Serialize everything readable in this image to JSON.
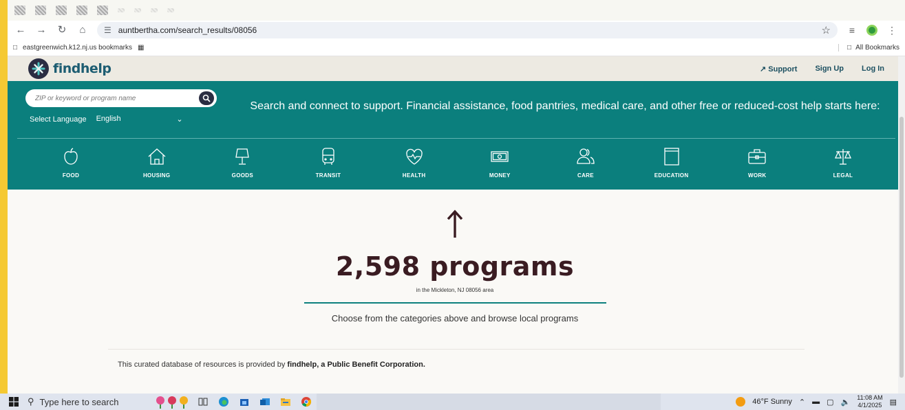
{
  "browser": {
    "url": "auntbertha.com/search_results/08056",
    "bookmark_folder": "eastgreenwich.k12.nj.us bookmarks",
    "all_bookmarks": "All Bookmarks"
  },
  "site": {
    "logo_text": "findhelp",
    "header_links": {
      "support": "Support",
      "sign_up": "Sign Up",
      "log_in": "Log In"
    },
    "search_placeholder": "ZIP or keyword or program name",
    "language_label": "Select Language",
    "language_value": "English",
    "tagline": "Search and connect to support. Financial assistance, food pantries, medical care, and other free or reduced-cost help starts here:",
    "categories": [
      "FOOD",
      "HOUSING",
      "GOODS",
      "TRANSIT",
      "HEALTH",
      "MONEY",
      "CARE",
      "EDUCATION",
      "WORK",
      "LEGAL"
    ],
    "colors": {
      "teal": "#0b7f7d",
      "navy": "#2b2d42",
      "count_text": "#3a1c22"
    }
  },
  "results": {
    "count_text": "2,598 programs",
    "area_text": "in the Mickleton, NJ 08056 area",
    "choose_text": "Choose from the categories above and browse local programs"
  },
  "footer": {
    "curated_prefix": "This curated database of resources is provided by ",
    "curated_bold": "findhelp, a Public Benefit Corporation."
  },
  "taskbar": {
    "search_placeholder": "Type here to search",
    "weather": "46°F  Sunny",
    "time": "11:08 AM",
    "date": "4/1/2025"
  }
}
